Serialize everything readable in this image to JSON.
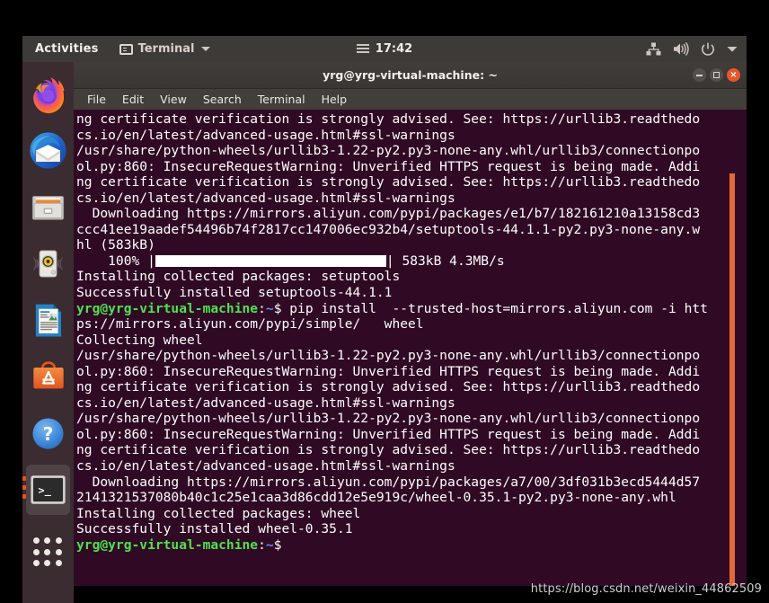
{
  "topbar": {
    "activities": "Activities",
    "app_name": "Terminal",
    "app_icon": "terminal-icon",
    "menu_icon": "hamburger-icon",
    "clock": "17:42",
    "indicators": [
      {
        "name": "network-icon"
      },
      {
        "name": "volume-icon"
      },
      {
        "name": "power-icon"
      },
      {
        "name": "chevron-down-icon"
      }
    ]
  },
  "dock": {
    "items": [
      {
        "name": "dock-item-firefox",
        "label": "Firefox",
        "icon": "firefox-icon",
        "active": false
      },
      {
        "name": "dock-item-thunderbird",
        "label": "Thunderbird Mail",
        "icon": "thunderbird-icon",
        "active": false
      },
      {
        "name": "dock-item-files",
        "label": "Files",
        "icon": "files-icon",
        "active": false
      },
      {
        "name": "dock-item-rhythmbox",
        "label": "Rhythmbox",
        "icon": "rhythmbox-icon",
        "active": false
      },
      {
        "name": "dock-item-libreoffice",
        "label": "LibreOffice Writer",
        "icon": "libreoffice-writer-icon",
        "active": false
      },
      {
        "name": "dock-item-ubuntu-software",
        "label": "Ubuntu Software",
        "icon": "ubuntu-software-icon",
        "active": false
      },
      {
        "name": "dock-item-help",
        "label": "Help",
        "icon": "help-icon",
        "active": false
      },
      {
        "name": "dock-item-terminal",
        "label": "Terminal",
        "icon": "terminal-icon",
        "active": true
      }
    ],
    "show_apps_label": "Show Applications",
    "show_apps_icon": "grid-icon"
  },
  "window": {
    "title": "yrg@yrg-virtual-machine: ~",
    "buttons": {
      "minimize": "minimize-button",
      "maximize": "maximize-button",
      "close": "×"
    },
    "menu": [
      "File",
      "Edit",
      "View",
      "Search",
      "Terminal",
      "Help"
    ]
  },
  "terminal": {
    "prompt_user": "yrg@yrg-virtual-machine",
    "prompt_colon": ":",
    "prompt_path": "~",
    "prompt_sigil": "$",
    "progress": {
      "percent": "100%",
      "size": "583kB",
      "speed": "4.3MB/s"
    },
    "lines": [
      "ng certificate verification is strongly advised. See: https://urllib3.readthedo",
      "cs.io/en/latest/advanced-usage.html#ssl-warnings",
      "/usr/share/python-wheels/urllib3-1.22-py2.py3-none-any.whl/urllib3/connectionpo",
      "ol.py:860: InsecureRequestWarning: Unverified HTTPS request is being made. Addi",
      "ng certificate verification is strongly advised. See: https://urllib3.readthedo",
      "cs.io/en/latest/advanced-usage.html#ssl-warnings",
      "  Downloading https://mirrors.aliyun.com/pypi/packages/e1/b7/182161210a13158cd3",
      "ccc41ee19aadef54496b74f2817cc147006ec932b4/setuptools-44.1.1-py2.py3-none-any.w",
      "hl (583kB)",
      "PROGRESS_BAR",
      "Installing collected packages: setuptools",
      "Successfully installed setuptools-44.1.1",
      "PROMPT_CMD_1",
      "ps://mirrors.aliyun.com/pypi/simple/   wheel",
      "Collecting wheel",
      "/usr/share/python-wheels/urllib3-1.22-py2.py3-none-any.whl/urllib3/connectionpo",
      "ol.py:860: InsecureRequestWarning: Unverified HTTPS request is being made. Addi",
      "ng certificate verification is strongly advised. See: https://urllib3.readthedo",
      "cs.io/en/latest/advanced-usage.html#ssl-warnings",
      "/usr/share/python-wheels/urllib3-1.22-py2.py3-none-any.whl/urllib3/connectionpo",
      "ol.py:860: InsecureRequestWarning: Unverified HTTPS request is being made. Addi",
      "ng certificate verification is strongly advised. See: https://urllib3.readthedo",
      "cs.io/en/latest/advanced-usage.html#ssl-warnings",
      "  Downloading https://mirrors.aliyun.com/pypi/packages/a7/00/3df031b3ecd5444d57",
      "2141321537080b40c1c25e1caa3d86cdd12e5e919c/wheel-0.35.1-py2.py3-none-any.whl",
      "Installing collected packages: wheel",
      "Successfully installed wheel-0.35.1",
      "PROMPT_ONLY"
    ],
    "command_1": " pip install  --trusted-host=mirrors.aliyun.com -i htt"
  },
  "watermark": "https://blog.csdn.net/weixin_44862509",
  "colors": {
    "terminal_bg": "#300a24",
    "topbar_bg": "#3c3b37",
    "dock_bg": "#3a2c31",
    "accent_orange": "#e8560f",
    "prompt_green": "#4ee24e",
    "prompt_blue": "#6a8cf0",
    "scrollbar": "#e2683c",
    "close_button": "#e9552a"
  }
}
